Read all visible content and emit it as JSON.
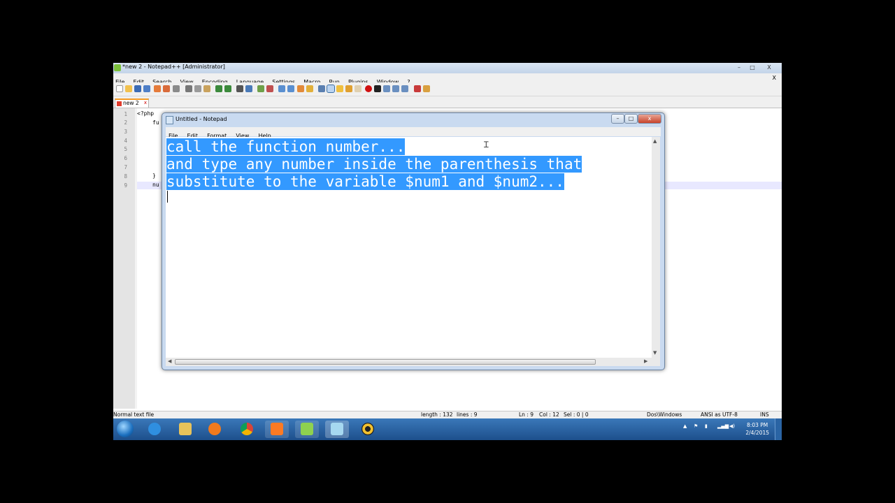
{
  "npp": {
    "title": "*new  2 - Notepad++ [Administrator]",
    "menu": [
      "File",
      "Edit",
      "Search",
      "View",
      "Encoding",
      "Language",
      "Settings",
      "Macro",
      "Run",
      "Plugins",
      "Window",
      "?"
    ],
    "menu_close": "X",
    "tab_label": "new  2",
    "tab_close": "x",
    "line_numbers": [
      "1",
      "2",
      "3",
      "4",
      "5",
      "6",
      "7",
      "8",
      "9"
    ],
    "code": {
      "l1": "<?php",
      "l2": "fu",
      "l8": "}",
      "l9": "nu"
    },
    "window_controls": {
      "min": "–",
      "max": "□",
      "close": "X"
    }
  },
  "status": {
    "filetype": "Normal text file",
    "length": "length : 132",
    "lines": "lines : 9",
    "ln": "Ln : 9",
    "col": "Col : 12",
    "sel": "Sel : 0 | 0",
    "eol": "Dos\\Windows",
    "encoding": "ANSI as UTF-8",
    "mode": "INS"
  },
  "notepad": {
    "title": "Untitled - Notepad",
    "menu": [
      "File",
      "Edit",
      "Format",
      "View",
      "Help"
    ],
    "lines": [
      "call the function number...",
      "and type any number inside the parenthesis that",
      "substitute to the variable $num1 and $num2..."
    ],
    "controls": {
      "min": "–",
      "max": "□",
      "close": "x"
    }
  },
  "taskbar": {
    "apps": [
      "start-orb",
      "internet-explorer",
      "file-explorer",
      "media-player",
      "chrome",
      "xampp",
      "notepad-plus-plus",
      "notepad",
      "music-player"
    ],
    "time": "8:03 PM",
    "date": "2/4/2015"
  },
  "colors": {
    "selection": "#3399ff",
    "taskbar": "#2a5f9e",
    "tab_accent": "#f59a23"
  }
}
